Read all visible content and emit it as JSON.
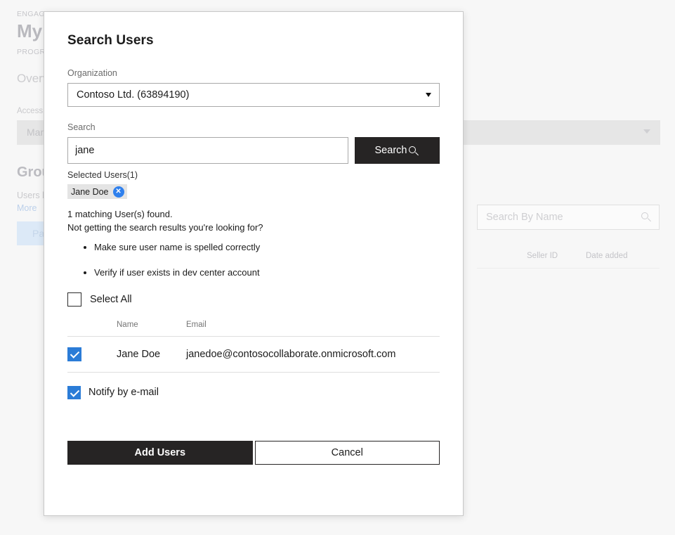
{
  "background": {
    "eyebrow": "ENGAGEMENT",
    "title": "My",
    "sub_eyebrow": "PROGRAM",
    "tab_label": "Overview",
    "access_label": "Access level",
    "access_value": "Manage",
    "group_title": "Group",
    "description": "Users below associated",
    "more_link": "More",
    "pill_label": "Partner",
    "search_placeholder": "Search By Name",
    "search_icon": "search-icon",
    "table_headers": [
      "Seller ID",
      "Date added"
    ],
    "dropdown_icon": "chevron-down-icon"
  },
  "modal": {
    "title": "Search Users",
    "organization": {
      "label": "Organization",
      "selected": "Contoso Ltd. (63894190)",
      "dropdown_icon": "chevron-down-icon"
    },
    "search": {
      "label": "Search",
      "value": "jane",
      "placeholder": "",
      "button_label": "Search",
      "button_icon": "search-icon"
    },
    "selected_users": {
      "label": "Selected Users(1)",
      "chips": [
        {
          "label": "Jane Doe",
          "remove_icon": "close-icon",
          "remove_glyph": "✕"
        }
      ]
    },
    "results": {
      "count_text": "1 matching User(s) found.",
      "prompt_text": "Not getting the search results you're looking for?",
      "hints": [
        "Make sure user name is spelled correctly",
        "Verify if user exists in dev center account"
      ]
    },
    "select_all": {
      "label": "Select All",
      "checked": false
    },
    "table": {
      "columns": [
        "Name",
        "Email"
      ],
      "rows": [
        {
          "checked": true,
          "name": "Jane Doe",
          "email": "janedoe@contosocollaborate.onmicrosoft.com"
        }
      ]
    },
    "notify": {
      "label": "Notify by e-mail",
      "checked": true
    },
    "actions": {
      "primary_label": "Add Users",
      "secondary_label": "Cancel"
    }
  },
  "colors": {
    "accent_blue": "#2b7cd7",
    "chip_blue": "#2f80ed",
    "dark_button": "#262424",
    "page_background": "#f7f7f7",
    "modal_background": "#ffffff"
  }
}
